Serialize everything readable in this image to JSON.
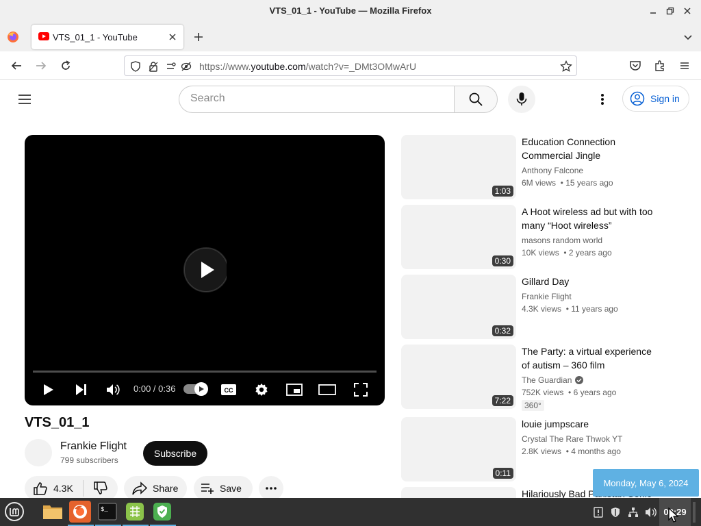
{
  "window": {
    "title": "VTS_01_1 - YouTube — Mozilla Firefox"
  },
  "tabs": [
    {
      "label": "VTS_01_1 - YouTube"
    }
  ],
  "navbar": {
    "url_prefix": "https://www.",
    "url_domain": "youtube.com",
    "url_path": "/watch?v=_DMt3OMwArU"
  },
  "youtube": {
    "search_placeholder": "Search",
    "signin_label": "Sign in",
    "player": {
      "time": "0:00 / 0:36",
      "progress": 0.0
    },
    "video_title": "VTS_01_1",
    "channel": {
      "name": "Frankie Flight",
      "subscribers": "799 subscribers"
    },
    "subscribe_label": "Subscribe",
    "actions": {
      "likes": "4.3K",
      "share": "Share",
      "save": "Save"
    },
    "recommendations": [
      {
        "title": "Education Connection Commercial Jingle",
        "channel": "Anthony Falcone",
        "views": "6M views",
        "age": "15 years ago",
        "duration": "1:03"
      },
      {
        "title": "A Hoot wireless ad but with too many “Hoot wireless”",
        "channel": "masons random world",
        "views": "10K views",
        "age": "2 years ago",
        "duration": "0:30"
      },
      {
        "title": "Gillard Day",
        "channel": "Frankie Flight",
        "views": "4.3K views",
        "age": "11 years ago",
        "duration": "0:32"
      },
      {
        "title": "The Party: a virtual experience of autism – 360 film",
        "channel": "The Guardian",
        "views": "752K views",
        "age": "6 years ago",
        "duration": "7:22",
        "badge": "360°"
      },
      {
        "title": "louie jumpscare",
        "channel": "Crystal The Rare Thwok YT",
        "views": "2.8K views",
        "age": "4 months ago",
        "duration": "0:11"
      },
      {
        "title": "Hilariously Bad Pakistan Sonic"
      }
    ]
  },
  "tooltip": {
    "date": "Monday, May 6, 2024"
  },
  "taskbar": {
    "clock": "09:29"
  },
  "colors": {
    "yt_red": "#ff0000",
    "link_blue": "#065fd4",
    "taskbar": "#303030",
    "accent": "#5fb1e3"
  }
}
